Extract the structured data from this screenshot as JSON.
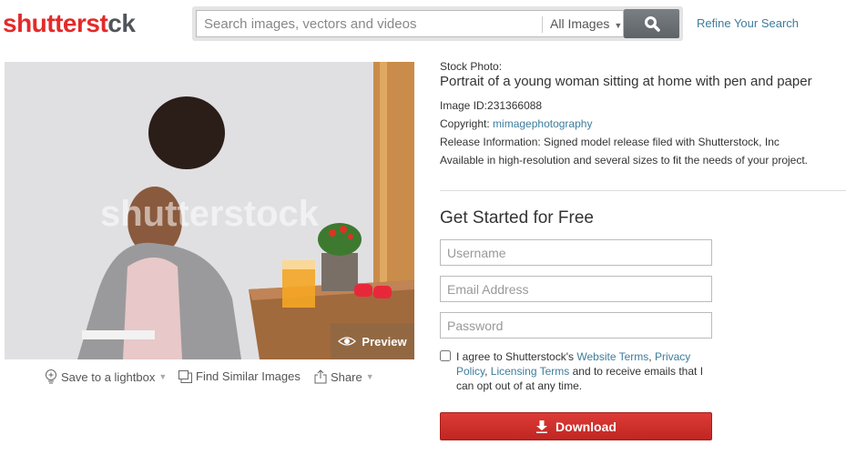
{
  "header": {
    "logo_part1": "shutterst",
    "logo_part2": "ck",
    "search_placeholder": "Search images, vectors and videos",
    "search_value": "",
    "category_select": "All Images",
    "search_button_icon": "search-icon",
    "refine_link": "Refine Your Search"
  },
  "image": {
    "watermark": "shutterstock",
    "preview_label": "Preview",
    "actions": [
      {
        "label": "Save to a lightbox",
        "icon": "lightbulb-plus-icon",
        "has_dropdown": true
      },
      {
        "label": "Find Similar Images",
        "icon": "similar-images-icon",
        "has_dropdown": false
      },
      {
        "label": "Share",
        "icon": "share-icon",
        "has_dropdown": true
      }
    ]
  },
  "details": {
    "type_label": "Stock Photo:",
    "title": "Portrait of a young woman sitting at home with pen and paper",
    "image_id_label": "Image ID:",
    "image_id": "231366088",
    "copyright_label": "Copyright:",
    "copyright_holder": "mimagephotography",
    "release_info": "Release Information: Signed model release filed with Shutterstock, Inc",
    "availability": "Available in high-resolution and several sizes to fit the needs of your project."
  },
  "signup": {
    "heading": "Get Started for Free",
    "username_placeholder": "Username",
    "email_placeholder": "Email Address",
    "password_placeholder": "Password",
    "agree_prefix": "I agree to Shutterstock's ",
    "website_terms": "Website Terms",
    "comma1": ", ",
    "privacy_policy": "Privacy Policy",
    "comma2": ", ",
    "licensing_terms": "Licensing Terms",
    "agree_suffix": " and to receive emails that I can opt out of at any time.",
    "agree_checked": false,
    "download_label": "Download"
  },
  "colors": {
    "brand_red": "#e32a2a",
    "link_blue": "#3e7c9c",
    "download_red": "#d0302c"
  }
}
